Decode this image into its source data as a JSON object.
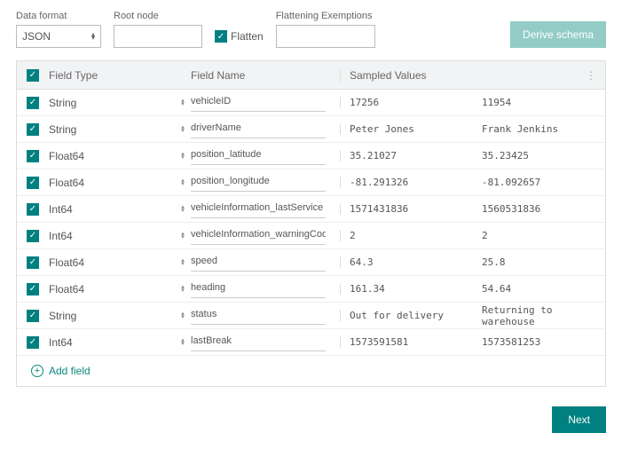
{
  "controls": {
    "data_format_label": "Data format",
    "data_format_value": "JSON",
    "root_node_label": "Root node",
    "root_node_value": "",
    "flatten_label": "Flatten",
    "flatten_checked": true,
    "exemptions_label": "Flattening Exemptions",
    "exemptions_value": "",
    "derive_schema_label": "Derive schema"
  },
  "headers": {
    "field_type": "Field Type",
    "field_name": "Field Name",
    "sampled_values": "Sampled Values"
  },
  "rows": [
    {
      "checked": true,
      "type": "String",
      "name": "vehicleID",
      "s1": "17256",
      "s2": "11954"
    },
    {
      "checked": true,
      "type": "String",
      "name": "driverName",
      "s1": "Peter Jones",
      "s2": "Frank Jenkins"
    },
    {
      "checked": true,
      "type": "Float64",
      "name": "position_latitude",
      "s1": "35.21027",
      "s2": "35.23425"
    },
    {
      "checked": true,
      "type": "Float64",
      "name": "position_longitude",
      "s1": "-81.291326",
      "s2": "-81.092657"
    },
    {
      "checked": true,
      "type": "Int64",
      "name": "vehicleInformation_lastService",
      "s1": "1571431836",
      "s2": "1560531836"
    },
    {
      "checked": true,
      "type": "Int64",
      "name": "vehicleInformation_warningCod",
      "s1": "2",
      "s2": "2"
    },
    {
      "checked": true,
      "type": "Float64",
      "name": "speed",
      "s1": "64.3",
      "s2": "25.8"
    },
    {
      "checked": true,
      "type": "Float64",
      "name": "heading",
      "s1": "161.34",
      "s2": "54.64"
    },
    {
      "checked": true,
      "type": "String",
      "name": "status",
      "s1": "Out for delivery",
      "s2": "Returning to warehouse"
    },
    {
      "checked": true,
      "type": "Int64",
      "name": "lastBreak",
      "s1": "1573591581",
      "s2": "1573581253"
    }
  ],
  "add_field_label": "Add field",
  "footer": {
    "next_label": "Next"
  },
  "glyphs": {
    "check": "✓",
    "more": "⋮",
    "up": "▴",
    "down": "▾",
    "plus": "+"
  }
}
